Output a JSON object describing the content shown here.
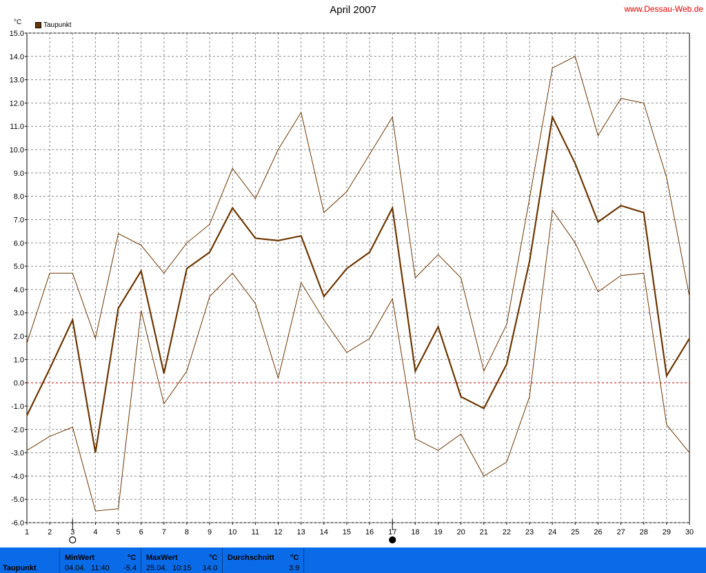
{
  "header": {
    "title": "April 2007",
    "site": "www.Dessau-Web.de",
    "unit": "°C"
  },
  "legend": {
    "label": "Taupunkt",
    "color": "#6b3500"
  },
  "chart_data": {
    "type": "line",
    "title": "April 2007",
    "ylabel": "°C",
    "x": [
      1,
      2,
      3,
      4,
      5,
      6,
      7,
      8,
      9,
      10,
      11,
      12,
      13,
      14,
      15,
      16,
      17,
      18,
      19,
      20,
      21,
      22,
      23,
      24,
      25,
      26,
      27,
      28,
      29,
      30
    ],
    "ylim": [
      -6.0,
      15.0
    ],
    "yticks": [
      "15.0",
      "14.0",
      "13.0",
      "12.0",
      "11.0",
      "10.0",
      "9.0",
      "8.0",
      "7.0",
      "6.0",
      "5.0",
      "4.0",
      "3.0",
      "2.0",
      "1.0",
      "0.0",
      "-1.0",
      "-2.0",
      "-3.0",
      "-4.0",
      "-5.0",
      "-6.0"
    ],
    "grid": true,
    "series": [
      {
        "name": "Taupunkt",
        "values": [
          -1.4,
          0.6,
          2.7,
          -3.0,
          3.2,
          4.8,
          0.4,
          4.9,
          5.6,
          7.5,
          6.2,
          6.1,
          6.3,
          3.7,
          4.9,
          5.6,
          7.5,
          0.5,
          2.4,
          -0.6,
          -1.1,
          0.8,
          5.2,
          11.4,
          9.4,
          6.9,
          7.6,
          7.3,
          0.3,
          1.9
        ]
      },
      {
        "values": [
          1.7,
          4.7,
          4.7,
          1.9,
          6.4,
          5.9,
          4.7,
          6.0,
          6.8,
          9.2,
          7.9,
          10.0,
          11.6,
          7.3,
          8.2,
          9.8,
          11.4,
          4.5,
          5.5,
          4.5,
          0.5,
          2.5,
          7.9,
          13.5,
          14.0,
          10.6,
          12.2,
          12.0,
          8.8,
          3.7
        ]
      },
      {
        "values": [
          -2.9,
          -2.3,
          -1.9,
          -5.5,
          -5.4,
          3.1,
          -0.9,
          0.5,
          3.7,
          4.7,
          3.4,
          0.2,
          4.3,
          2.7,
          1.3,
          1.9,
          3.6,
          -2.4,
          -2.9,
          -2.2,
          -4.0,
          -3.4,
          -0.6,
          7.4,
          6.0,
          3.9,
          4.6,
          4.7,
          -1.8,
          -3.0
        ]
      }
    ],
    "markers": [
      {
        "day": 3,
        "icon": "new-moon-icon"
      },
      {
        "day": 17,
        "icon": "full-moon-icon"
      }
    ]
  },
  "stats": {
    "row_label": "Taupunkt",
    "min": {
      "label": "MinWert",
      "unit": "°C",
      "date": "04.04.",
      "time": "11:40",
      "value": "-5.4"
    },
    "max": {
      "label": "MaxWert",
      "unit": "°C",
      "date": "25.04.",
      "time": "10:15",
      "value": "14.0"
    },
    "avg": {
      "label": "Durchschnitt",
      "unit": "°C",
      "value": "3.9"
    }
  }
}
